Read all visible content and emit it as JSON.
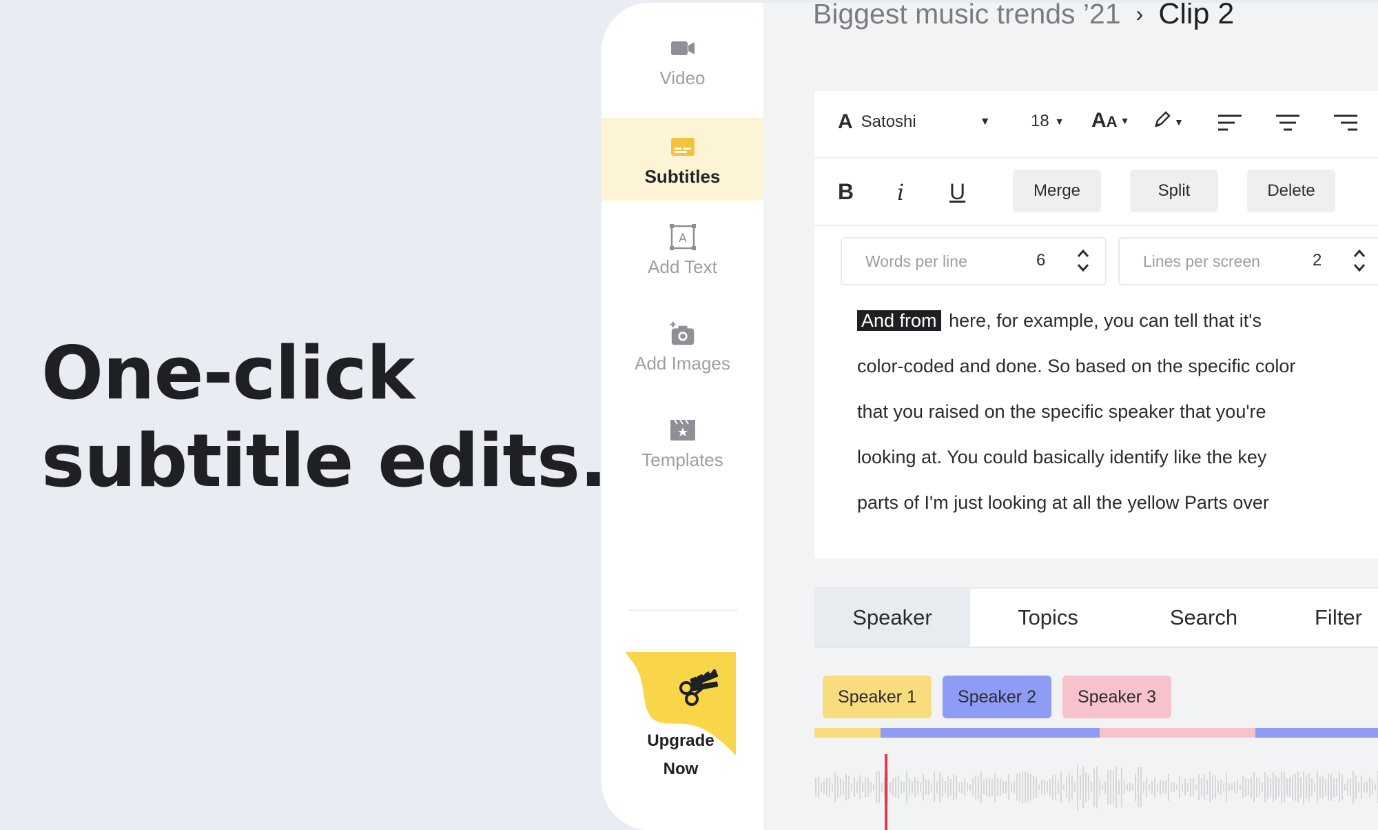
{
  "headline": {
    "line1": "One-click",
    "line2": "subtitle edits."
  },
  "sidebar": {
    "items": [
      {
        "label": "Video",
        "icon": "video-camera-icon"
      },
      {
        "label": "Subtitles",
        "icon": "subtitles-icon",
        "active": true
      },
      {
        "label": "Add Text",
        "icon": "add-text-icon"
      },
      {
        "label": "Add Images",
        "icon": "add-image-icon"
      },
      {
        "label": "Templates",
        "icon": "templates-icon"
      }
    ],
    "upgrade": {
      "line1": "Upgrade",
      "line2": "Now",
      "icon": "scissors-clapper-icon",
      "color": "#f9d54a"
    }
  },
  "breadcrumb": {
    "parent": "Biggest music trends ’21",
    "separator": "›",
    "current": "Clip 2"
  },
  "toolbar": {
    "font_name": "Satoshi",
    "font_size": "18",
    "merge": "Merge",
    "split": "Split",
    "delete": "Delete",
    "bold": "B",
    "italic": "i",
    "underline": "U"
  },
  "settings": {
    "words_per_line": {
      "label": "Words per line",
      "value": "6"
    },
    "lines_per_screen": {
      "label": "Lines per screen",
      "value": "2"
    }
  },
  "transcript": {
    "highlight": "And from",
    "line1": "here, for example, you can tell that it's",
    "line2": "color-coded and done. So based on the specific color",
    "line3": "that you raised on the specific speaker that you're",
    "line4": "looking at. You could basically identify like the key",
    "line5": "parts of I'm just looking at all the yellow Parts over"
  },
  "tabs": [
    "Speaker",
    "Topics",
    "Search",
    "Filter"
  ],
  "speakers": [
    {
      "label": "Speaker 1",
      "color": "#f8dc7e"
    },
    {
      "label": "Speaker 2",
      "color": "#8e9cf5"
    },
    {
      "label": "Speaker 3",
      "color": "#f6c2cb"
    }
  ],
  "colors": {
    "accent_yellow": "#f9d54a",
    "playhead": "#e8374a"
  }
}
